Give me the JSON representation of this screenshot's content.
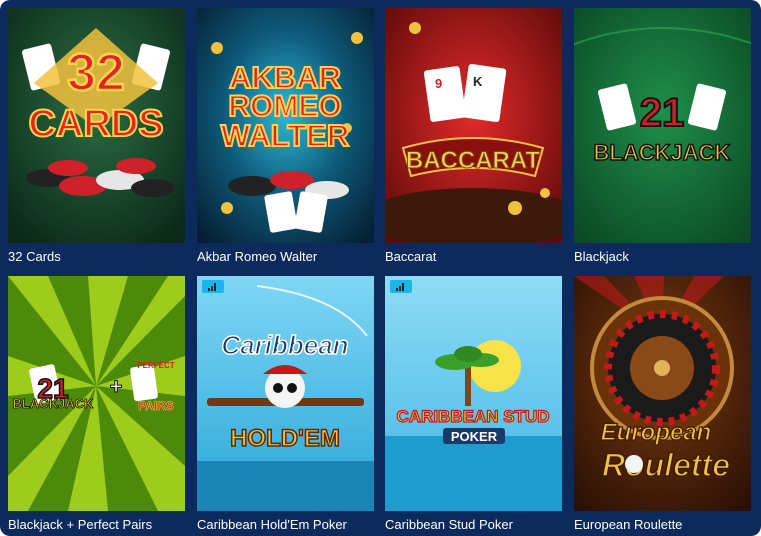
{
  "games": [
    {
      "caption": "32 Cards",
      "art": {
        "line1": "32",
        "line2": "CARDS"
      }
    },
    {
      "caption": "Akbar Romeo Walter",
      "art": {
        "line1": "AKBAR",
        "line2": "ROMEO",
        "line3": "WALTER"
      }
    },
    {
      "caption": "Baccarat",
      "art": {
        "line1": "BACCARAT"
      }
    },
    {
      "caption": "Blackjack",
      "art": {
        "line1": "21",
        "line2": "BLACKJACK"
      }
    },
    {
      "caption": "Blackjack + Perfect Pairs",
      "art": {
        "line1": "21",
        "line2": "BLACKJACK",
        "plus": "+",
        "pp1": "PERFECT",
        "pp2": "PAIRS"
      }
    },
    {
      "caption": "Caribbean Hold'Em Poker",
      "art": {
        "line1": "Caribbean",
        "line2": "HOLD'EM"
      }
    },
    {
      "caption": "Caribbean Stud Poker",
      "art": {
        "line1": "CARIBBEAN STUD",
        "line2": "POKER"
      }
    },
    {
      "caption": "European Roulette",
      "art": {
        "line1": "European",
        "line2": "Roulette"
      }
    }
  ],
  "colors": {
    "background": "#0d2a5c",
    "caption": "#ffffff",
    "badge": "#18b6ea"
  },
  "icons": {
    "badge": "signal-bars-icon"
  }
}
